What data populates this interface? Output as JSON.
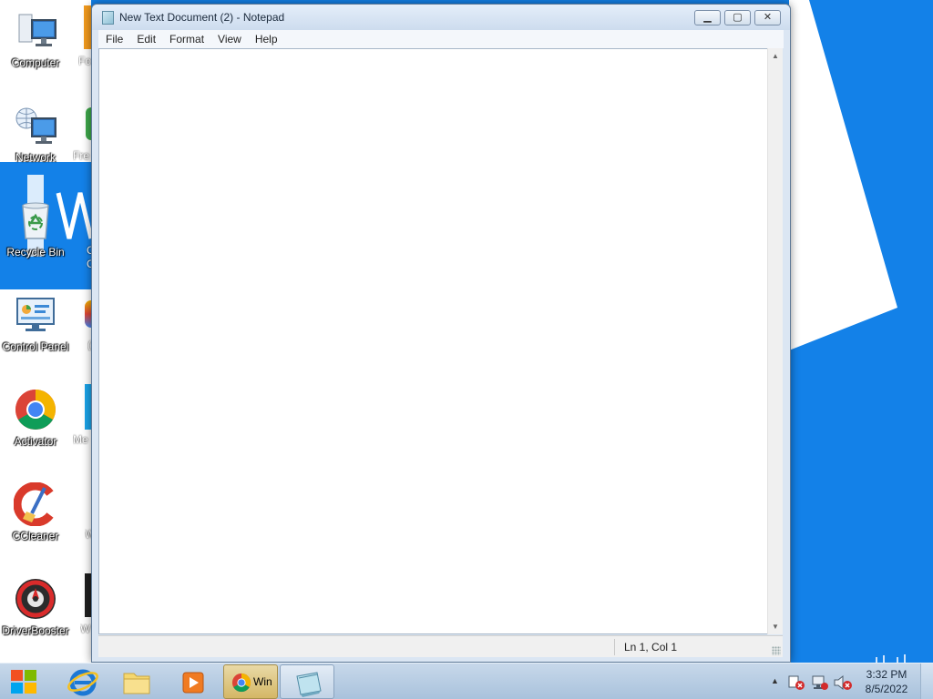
{
  "desktop": {
    "icons": [
      {
        "label": "Computer",
        "icon": "computer-icon"
      },
      {
        "label": "Network",
        "icon": "network-icon"
      },
      {
        "label": "Recycle Bin",
        "icon": "recycle-bin-icon"
      },
      {
        "label": "Control Panel",
        "icon": "control-panel-icon"
      },
      {
        "label": "Activator",
        "icon": "chrome-icon"
      },
      {
        "label": "CCleaner",
        "icon": "ccleaner-icon"
      },
      {
        "label": "DriverBooster",
        "icon": "driverbooster-icon"
      }
    ],
    "partial_labels": [
      "Fo",
      "Fre",
      "C",
      "C",
      "(",
      "Me",
      "W",
      "W"
    ]
  },
  "notepad": {
    "title": "New Text Document (2) - Notepad",
    "menu": [
      "File",
      "Edit",
      "Format",
      "View",
      "Help"
    ],
    "content": "",
    "status_position": "Ln 1, Col 1"
  },
  "taskbar": {
    "pinned": [
      {
        "name": "internet-explorer-icon"
      },
      {
        "name": "file-explorer-icon"
      },
      {
        "name": "media-player-icon"
      }
    ],
    "running": [
      {
        "name": "chrome-taskbar-button",
        "label": "Win",
        "state": "active"
      },
      {
        "name": "notepad-taskbar-button",
        "state": "open"
      }
    ],
    "tray": {
      "time": "3:32 PM",
      "date": "8/5/2022"
    }
  },
  "colors": {
    "wallpaper": "#1381e8",
    "taskbar_active": "#d4b766"
  }
}
